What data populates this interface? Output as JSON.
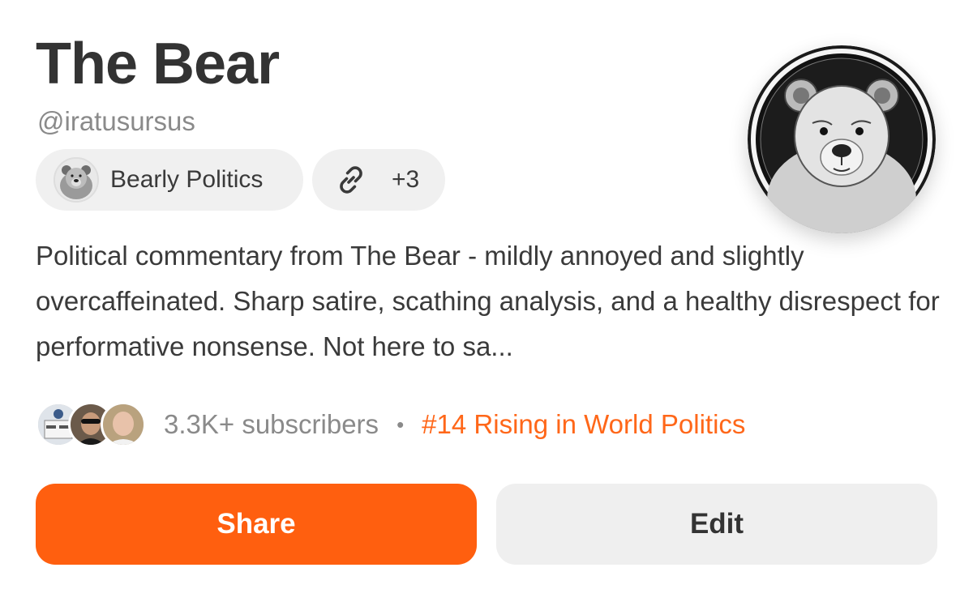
{
  "profile": {
    "name": "The Bear",
    "handle": "@iratusursus",
    "bio": "Political commentary from The Bear - mildly annoyed and slightly overcaffeinated. Sharp satire, scathing analysis, and a healthy disrespect for performative nonsense. Not here to sa..."
  },
  "publication": {
    "name": "Bearly Politics",
    "avatar_icon": "bear-avatar-icon"
  },
  "links": {
    "icon": "link-icon",
    "count_label": "+3"
  },
  "stats": {
    "subscribers": "3.3K+ subscribers",
    "separator": "•",
    "rank": "#14 Rising in World Politics"
  },
  "actions": {
    "share_label": "Share",
    "edit_label": "Edit"
  },
  "colors": {
    "accent": "#ff6719",
    "share_button": "#ff5f0f",
    "pill_bg": "#f0f0f0",
    "edit_button": "#efefef"
  }
}
